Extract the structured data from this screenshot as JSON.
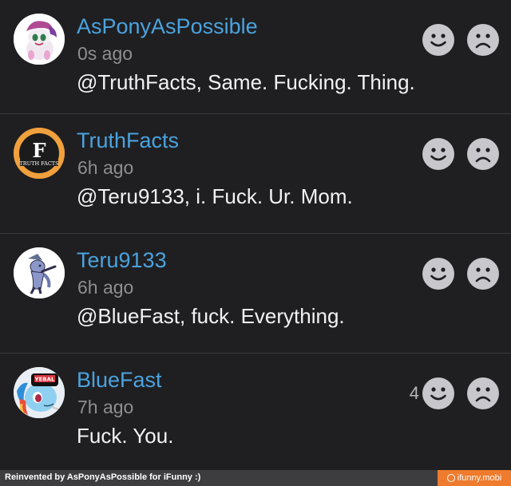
{
  "comments": [
    {
      "username": "AsPonyAsPossible",
      "time": "0s ago",
      "text": "@TruthFacts, Same. Fucking. Thing.",
      "avatar_icon": "pony-avatar-icon",
      "smile_count": ""
    },
    {
      "username": "TruthFacts",
      "time": "6h ago",
      "text": "@Teru9133, i. Fuck. Ur. Mom.",
      "avatar_icon": "truth-facts-logo-icon",
      "avatar_logo_letter": "F",
      "avatar_logo_text": "TRUTH FACTS",
      "smile_count": ""
    },
    {
      "username": "Teru9133",
      "time": "6h ago",
      "text": "@BlueFast, fuck. Everything.",
      "avatar_icon": "pony-sketch-avatar-icon",
      "smile_count": ""
    },
    {
      "username": "BlueFast",
      "time": "7h ago",
      "text": "Fuck. You.",
      "avatar_icon": "pony-cap-avatar-icon",
      "avatar_cap_text": "YEBAL",
      "smile_count": "4"
    }
  ],
  "reactions": {
    "smile_icon": "smile-icon",
    "frown_icon": "frown-icon",
    "icon_color": "#c7c7cc"
  },
  "footer": {
    "credit": "Reinvented by AsPonyAsPossible for iFunny :)",
    "brand": "ifunny.mobi",
    "brand_color": "#ee7b2e"
  }
}
